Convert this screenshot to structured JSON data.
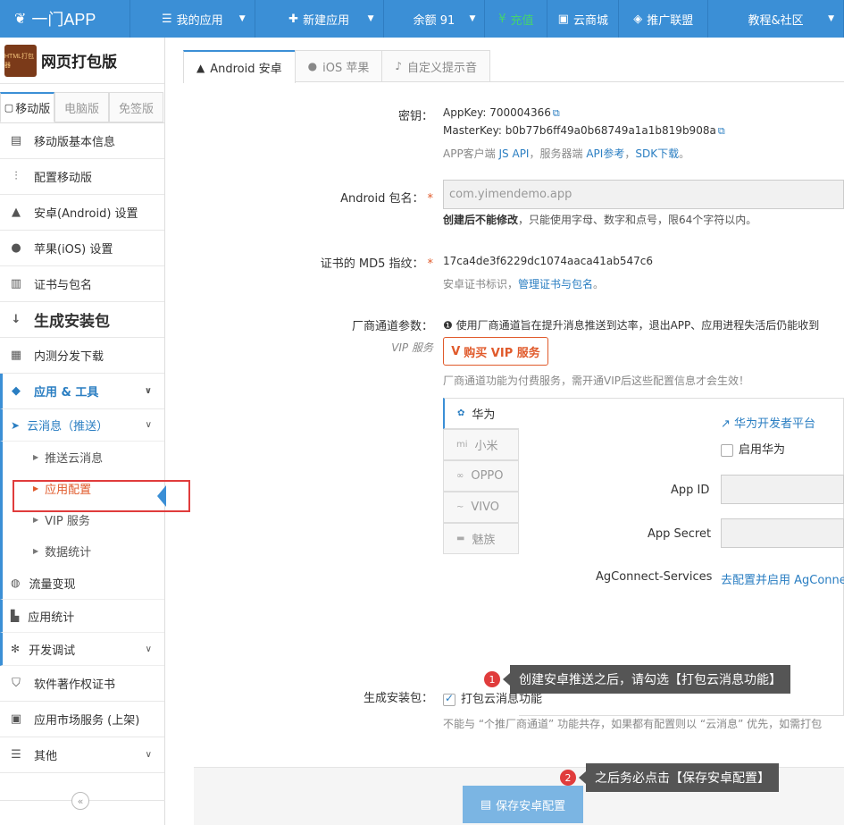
{
  "topbar": {
    "brand": "一门APP",
    "apps": "我的应用",
    "new_app": "新建应用",
    "balance": "余额 91",
    "recharge": "充值",
    "mall": "云商城",
    "promote": "推广联盟",
    "tutorial": "教程&社区"
  },
  "sidebar": {
    "app_logo_text": "HTML打包器",
    "app_name": "网页打包版",
    "ver_tabs": [
      "移动版",
      "电脑版",
      "免签版"
    ],
    "items": [
      {
        "label": "移动版基本信息",
        "icon": "list-icon"
      },
      {
        "label": "配置移动版",
        "icon": "sliders-icon"
      },
      {
        "label": "安卓(Android) 设置",
        "icon": "android-icon"
      },
      {
        "label": "苹果(iOS) 设置",
        "icon": "apple-icon"
      },
      {
        "label": "证书与包名",
        "icon": "certificate-icon"
      },
      {
        "label": "生成安装包",
        "icon": "sort-icon"
      },
      {
        "label": "内测分发下载",
        "icon": "qrcode-icon"
      },
      {
        "label": "应用 & 工具",
        "icon": "widgets-icon"
      }
    ],
    "cloud_msg": "云消息（推送）",
    "cloud_sub": [
      "推送云消息",
      "应用配置",
      "VIP 服务",
      "数据统计"
    ],
    "tools": [
      "流量变现",
      "应用统计",
      "开发调试"
    ],
    "bottom": [
      "软件著作权证书",
      "应用市场服务 (上架)",
      "其他"
    ],
    "collapse": "«"
  },
  "tabs": [
    "Android 安卓",
    "iOS 苹果",
    "自定义提示音"
  ],
  "form": {
    "secret_label": "密钥：",
    "appkey_label": "AppKey:",
    "appkey": "700004366",
    "masterkey_label": "MasterKey:",
    "masterkey": "b0b77b6ff49a0b68749a1a1b819b908a",
    "api_text": "APP客户端",
    "js_api": "JS API",
    "server_text": "，服务器端",
    "api_ref": "API参考",
    "comma": "，",
    "sdk": "SDK下载",
    "period": "。",
    "pkg_label": "Android 包名：",
    "pkg_value": "com.yimendemo.app",
    "pkg_hint_bold": "创建后不能修改",
    "pkg_hint": "，只能使用字母、数字和点号，限64个字符以内。",
    "md5_label": "证书的 MD5 指纹：",
    "md5_value": "17ca4de3f6229dc1074aaca41ab547c6",
    "md5_hint": "安卓证书标识，",
    "md5_link": "管理证书与包名",
    "md5_end": "。",
    "vendor_label": "厂商通道参数：",
    "vip_tag": "VIP 服务",
    "vendor_info": "使用厂商通道旨在提升消息推送到达率，退出APP、应用进程失活后仍能收到",
    "buy_vip": "购买 VIP 服务",
    "vendor_hint": "厂商通道功能为付费服务，需开通VIP后这些配置信息才会生效！",
    "vendors": [
      "华为",
      "小米",
      "OPPO",
      "VIVO",
      "魅族"
    ],
    "huawei_dev": "华为开发者平台",
    "enable_huawei": "启用华为",
    "app_id_label": "App ID",
    "app_secret_label": "App Secret",
    "ag_label": "AgConnect-Services",
    "ag_link": "去配置并启用 AgConnect",
    "build_label": "生成安装包：",
    "pack_cloud": "打包云消息功能",
    "build_hint": "不能与 “个推厂商通道” 功能共存，如果都有配置则以 “云消息” 优先，如需打包",
    "save_btn": "保存安卓配置"
  },
  "tips": [
    {
      "num": "1",
      "text": "创建安卓推送之后，请勾选【打包云消息功能】"
    },
    {
      "num": "2",
      "text": "之后务必点击【保存安卓配置】"
    }
  ]
}
